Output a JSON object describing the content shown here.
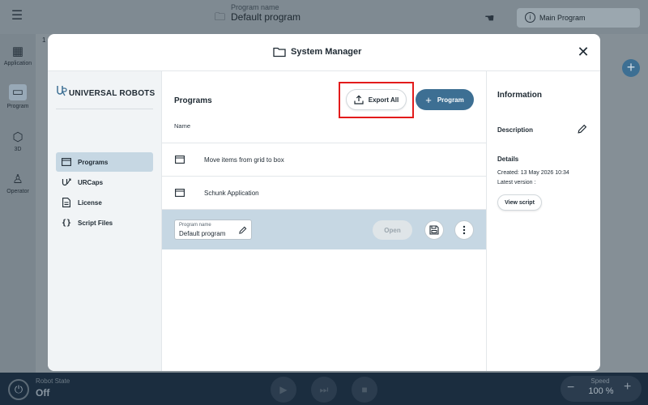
{
  "background_app": {
    "header": {
      "program_name_label": "Program name",
      "program_name": "Default program",
      "main_program_button": "Main Program"
    },
    "nav": [
      {
        "label": "Application",
        "icon": "application-grid-icon"
      },
      {
        "label": "Program",
        "icon": "program-icon"
      },
      {
        "label": "3D",
        "icon": "cube-icon"
      },
      {
        "label": "Operator",
        "icon": "person-icon"
      }
    ],
    "row_number": "1",
    "bottom_bar": {
      "robot_state_label": "Robot State",
      "robot_state_value": "Off",
      "speed_label": "Speed",
      "speed_value": "100 %",
      "speed_minus": "−",
      "speed_plus": "+"
    }
  },
  "modal": {
    "title": "System Manager",
    "close_glyph": "✕",
    "logo_text": "UNIVERSAL ROBOTS",
    "sidebar": [
      {
        "label": "Programs",
        "icon": "program-window-icon",
        "active": true
      },
      {
        "label": "URCaps",
        "icon": "urcaps-icon",
        "active": false
      },
      {
        "label": "License",
        "icon": "document-icon",
        "active": false
      },
      {
        "label": "Script Files",
        "icon": "script-braces-icon",
        "active": false
      }
    ],
    "programs": {
      "heading": "Programs",
      "export_all_label": "Export All",
      "add_program_label": "Program",
      "column_name": "Name",
      "rows": [
        {
          "name": "Move items from grid to box"
        },
        {
          "name": "Schunk Application"
        }
      ],
      "selected": {
        "field_label": "Program name",
        "field_value": "Default program",
        "open_label": "Open"
      }
    },
    "information": {
      "title": "Information",
      "description_label": "Description",
      "details_label": "Details",
      "created": "Created: 13 May 2026 10:34",
      "latest_version": "Latest version :",
      "view_script_label": "View script"
    }
  },
  "colors": {
    "accent": "#3d6f93",
    "selected_row": "#c6d7e3",
    "highlight_box": "#e31b1b",
    "bottom_bar": "#1b2d3f"
  }
}
